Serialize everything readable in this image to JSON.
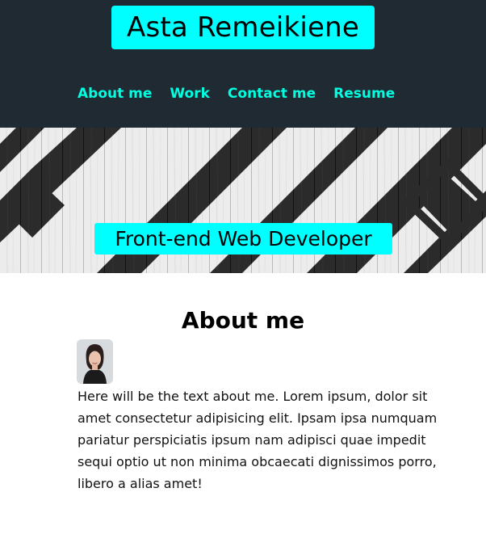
{
  "header": {
    "title": "Asta Remeikiene",
    "nav": [
      {
        "label": "About me"
      },
      {
        "label": "Work"
      },
      {
        "label": "Contact me"
      },
      {
        "label": "Resume"
      }
    ],
    "accent_color": "#00ffff",
    "background_color": "#202a33"
  },
  "hero": {
    "tagline": "Front-end Web Developer"
  },
  "about": {
    "heading": "About me",
    "avatar_icon": "profile-photo",
    "text": "Here will be the text about me. Lorem ipsum, dolor sit amet consectetur adipisicing elit. Ipsam ipsa numquam pariatur perspiciatis ipsum nam adipisci quae impedit sequi optio ut non minima obcaecati dignissimos porro, libero a alias amet!"
  }
}
